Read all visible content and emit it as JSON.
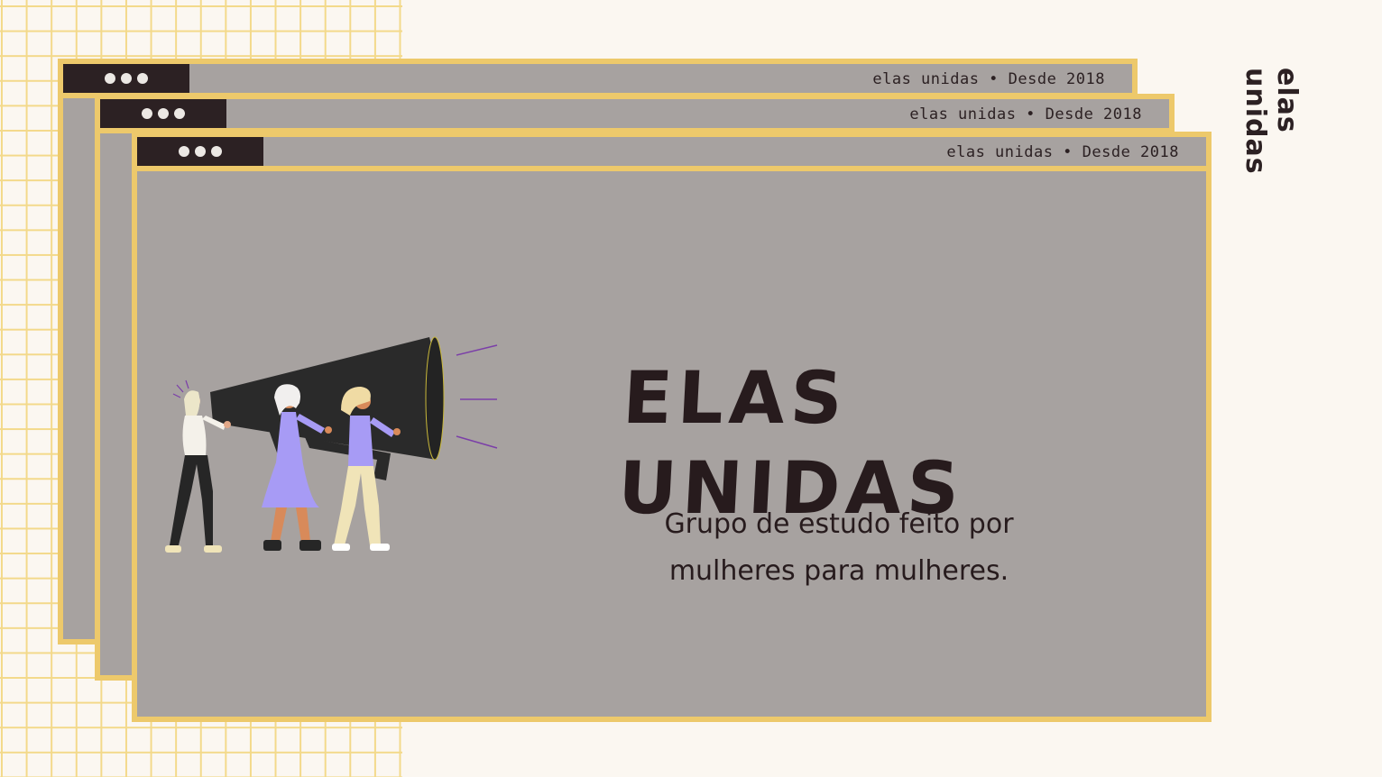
{
  "side_label": "elas unidas",
  "windows": [
    {
      "brand": "elas unidas • Desde 2018"
    },
    {
      "brand": "elas unidas • Desde 2018"
    },
    {
      "brand": "elas unidas • Desde 2018"
    }
  ],
  "hero": {
    "title": "ELAS UNIDAS",
    "subtitle_line1": "Grupo de estudo feito por",
    "subtitle_line2": "mulheres para mulheres."
  },
  "colors": {
    "background": "#fbf7f1",
    "grid": "#f3d98a",
    "window_fill": "#a7a2a0",
    "window_border": "#edc96b",
    "titlebar_dark": "#2c2123",
    "text": "#271b1d",
    "accent_purple": "#a79bf5"
  },
  "icons": [
    "megaphone-illustration",
    "window-dots-icon"
  ]
}
